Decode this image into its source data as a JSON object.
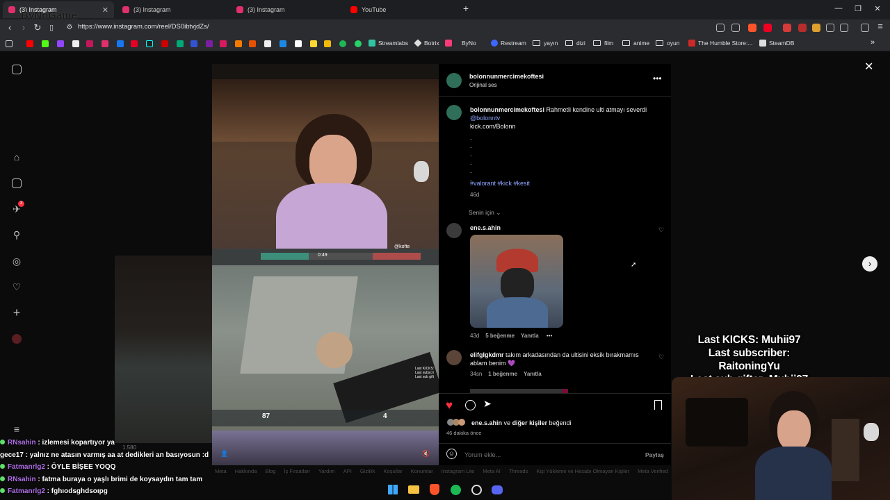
{
  "browser": {
    "tabs": [
      {
        "label": "(3) Instagram",
        "active": true,
        "icon": "instagram-icon",
        "color": "#e1306c"
      },
      {
        "label": "(3) Instagram",
        "active": false,
        "icon": "instagram-icon",
        "color": "#e1306c"
      },
      {
        "label": "(3) Instagram",
        "active": false,
        "icon": "instagram-icon",
        "color": "#e1306c"
      },
      {
        "label": "YouTube",
        "active": false,
        "icon": "youtube-icon",
        "color": "#ff0000"
      }
    ],
    "watermark": "ByNoGame",
    "url": "https://www.instagram.com/reel/DS0ibtvjdZs/",
    "bookmarks": [
      {
        "label": "Streamlabs",
        "icon": "streamlabs-icon",
        "color": "#31c3a2"
      },
      {
        "label": "Botrix",
        "icon": "botrix-icon",
        "color": "#dddddd"
      },
      {
        "label": "ByNo",
        "icon": "byno-icon",
        "color": "#ff3a7a"
      },
      {
        "label": "Restream",
        "icon": "restream-icon",
        "color": "#3c68ff"
      },
      {
        "label": "yayın",
        "icon": "folder-icon"
      },
      {
        "label": "dizi",
        "icon": "folder-icon"
      },
      {
        "label": "film",
        "icon": "folder-icon"
      },
      {
        "label": "anime",
        "icon": "folder-icon"
      },
      {
        "label": "oyun",
        "icon": "folder-icon"
      },
      {
        "label": "The Humble Store:...",
        "icon": "humble-icon",
        "color": "#cc2929"
      },
      {
        "label": "SteamDB",
        "icon": "steamdb-icon",
        "color": "#dddddd"
      }
    ]
  },
  "rail": {
    "notification_count": "3"
  },
  "post": {
    "author": "bolonnunmercimekoftesi",
    "audio": "Orijinal ses",
    "caption": {
      "username": "bolonnunmercimekoftesi",
      "text": "Rahmetli kendine ulti atmayı severdi",
      "mention": "@bolonntv",
      "line2": "kick.com/Bolonn",
      "dots": [
        ".",
        ".",
        ".",
        ".",
        ".",
        "."
      ],
      "hashtags": "#valorant #kick #kesit",
      "age": "46d"
    },
    "sort_label": "Senin için",
    "comments": [
      {
        "username": "ene.s.ahin",
        "text": "",
        "time": "43d",
        "likes": "5 beğenme",
        "reply": "Yanıtla",
        "more": "•••"
      },
      {
        "username": "elifglgkdmr",
        "text": "takım arkadasından da ultisini eksik bırakmamıs ablam benim 💜",
        "time": "34sn",
        "likes": "1 beğenme",
        "reply": "Yanıtla"
      }
    ],
    "liked_by": {
      "user": "ene.s.ahin",
      "connector": "ve",
      "others": "diğer kişiler",
      "suffix": "beğendi"
    },
    "posted_ago": "46 dakika önce",
    "comment_placeholder": "Yorum ekle...",
    "share_label": "Paylaş"
  },
  "video_overlay": {
    "cam_tag": "@kofte",
    "hud_timer": "0:49",
    "hud_hp": "87",
    "hud_ammo": "4",
    "view_count": "1.580",
    "kicks_text": "Last KICKS:\nLast subscri\nLast sub gift"
  },
  "stream_stats": {
    "kicks": "Last KICKS: Muhii97",
    "subscriber": "Last subscriber: RaitoningYu",
    "gifter": "Last sub gifter: Muhii97"
  },
  "chat": [
    {
      "user": "RNsahin",
      "msg": " : izlemesi kopartıyor ya",
      "badge": true
    },
    {
      "user": "gece17",
      "msg": " : yalnız ne atasın varmış aa at dedikleri an basıyosun :d",
      "badge": false
    },
    {
      "user": "Fatmanrlg2",
      "msg": " : ÖYLE BİŞEE YOQQ",
      "badge": true
    },
    {
      "user": "RNsahin",
      "msg": " : fatma buraya o yaşlı brimi de koysaydın tam tam",
      "badge": true
    },
    {
      "user": "Fatmanrlg2",
      "msg": " : fghıodsghdsoıpg",
      "badge": true
    }
  ],
  "footer_links": [
    "Meta",
    "Hakkında",
    "Blog",
    "İş Fırsatları",
    "Yardım",
    "API",
    "Gizlilik",
    "Koşullar",
    "Konumlar",
    "Instagram Lite",
    "Meta AI",
    "Threads",
    "Kişi Yükleme ve Hesabı Olmayan Kişiler",
    "Meta Verified"
  ],
  "colors": {
    "accent_link": "#8ea6ff",
    "like_red": "#ff3040",
    "panel_bg": "#000000"
  }
}
